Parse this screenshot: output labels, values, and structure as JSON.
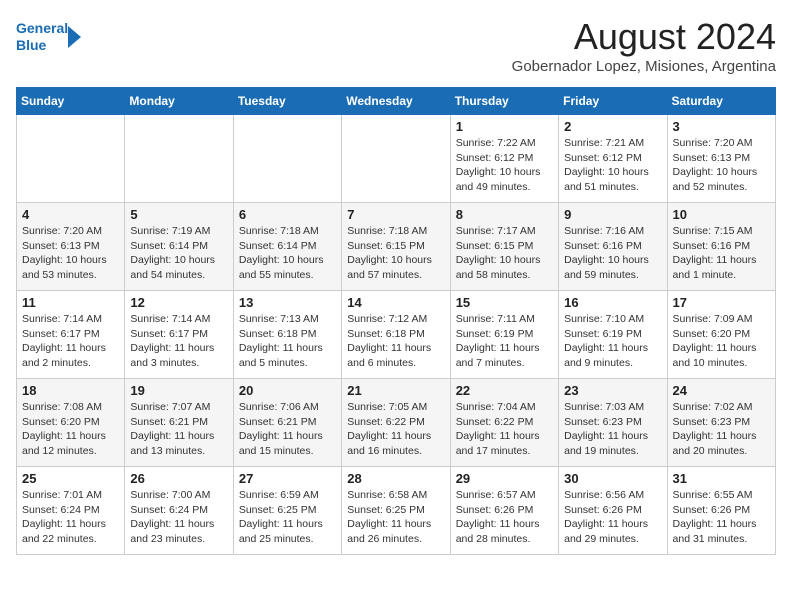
{
  "header": {
    "logo_line1": "General",
    "logo_line2": "Blue",
    "main_title": "August 2024",
    "subtitle": "Gobernador Lopez, Misiones, Argentina"
  },
  "days_of_week": [
    "Sunday",
    "Monday",
    "Tuesday",
    "Wednesday",
    "Thursday",
    "Friday",
    "Saturday"
  ],
  "weeks": [
    [
      {
        "num": "",
        "info": ""
      },
      {
        "num": "",
        "info": ""
      },
      {
        "num": "",
        "info": ""
      },
      {
        "num": "",
        "info": ""
      },
      {
        "num": "1",
        "info": "Sunrise: 7:22 AM\nSunset: 6:12 PM\nDaylight: 10 hours\nand 49 minutes."
      },
      {
        "num": "2",
        "info": "Sunrise: 7:21 AM\nSunset: 6:12 PM\nDaylight: 10 hours\nand 51 minutes."
      },
      {
        "num": "3",
        "info": "Sunrise: 7:20 AM\nSunset: 6:13 PM\nDaylight: 10 hours\nand 52 minutes."
      }
    ],
    [
      {
        "num": "4",
        "info": "Sunrise: 7:20 AM\nSunset: 6:13 PM\nDaylight: 10 hours\nand 53 minutes."
      },
      {
        "num": "5",
        "info": "Sunrise: 7:19 AM\nSunset: 6:14 PM\nDaylight: 10 hours\nand 54 minutes."
      },
      {
        "num": "6",
        "info": "Sunrise: 7:18 AM\nSunset: 6:14 PM\nDaylight: 10 hours\nand 55 minutes."
      },
      {
        "num": "7",
        "info": "Sunrise: 7:18 AM\nSunset: 6:15 PM\nDaylight: 10 hours\nand 57 minutes."
      },
      {
        "num": "8",
        "info": "Sunrise: 7:17 AM\nSunset: 6:15 PM\nDaylight: 10 hours\nand 58 minutes."
      },
      {
        "num": "9",
        "info": "Sunrise: 7:16 AM\nSunset: 6:16 PM\nDaylight: 10 hours\nand 59 minutes."
      },
      {
        "num": "10",
        "info": "Sunrise: 7:15 AM\nSunset: 6:16 PM\nDaylight: 11 hours\nand 1 minute."
      }
    ],
    [
      {
        "num": "11",
        "info": "Sunrise: 7:14 AM\nSunset: 6:17 PM\nDaylight: 11 hours\nand 2 minutes."
      },
      {
        "num": "12",
        "info": "Sunrise: 7:14 AM\nSunset: 6:17 PM\nDaylight: 11 hours\nand 3 minutes."
      },
      {
        "num": "13",
        "info": "Sunrise: 7:13 AM\nSunset: 6:18 PM\nDaylight: 11 hours\nand 5 minutes."
      },
      {
        "num": "14",
        "info": "Sunrise: 7:12 AM\nSunset: 6:18 PM\nDaylight: 11 hours\nand 6 minutes."
      },
      {
        "num": "15",
        "info": "Sunrise: 7:11 AM\nSunset: 6:19 PM\nDaylight: 11 hours\nand 7 minutes."
      },
      {
        "num": "16",
        "info": "Sunrise: 7:10 AM\nSunset: 6:19 PM\nDaylight: 11 hours\nand 9 minutes."
      },
      {
        "num": "17",
        "info": "Sunrise: 7:09 AM\nSunset: 6:20 PM\nDaylight: 11 hours\nand 10 minutes."
      }
    ],
    [
      {
        "num": "18",
        "info": "Sunrise: 7:08 AM\nSunset: 6:20 PM\nDaylight: 11 hours\nand 12 minutes."
      },
      {
        "num": "19",
        "info": "Sunrise: 7:07 AM\nSunset: 6:21 PM\nDaylight: 11 hours\nand 13 minutes."
      },
      {
        "num": "20",
        "info": "Sunrise: 7:06 AM\nSunset: 6:21 PM\nDaylight: 11 hours\nand 15 minutes."
      },
      {
        "num": "21",
        "info": "Sunrise: 7:05 AM\nSunset: 6:22 PM\nDaylight: 11 hours\nand 16 minutes."
      },
      {
        "num": "22",
        "info": "Sunrise: 7:04 AM\nSunset: 6:22 PM\nDaylight: 11 hours\nand 17 minutes."
      },
      {
        "num": "23",
        "info": "Sunrise: 7:03 AM\nSunset: 6:23 PM\nDaylight: 11 hours\nand 19 minutes."
      },
      {
        "num": "24",
        "info": "Sunrise: 7:02 AM\nSunset: 6:23 PM\nDaylight: 11 hours\nand 20 minutes."
      }
    ],
    [
      {
        "num": "25",
        "info": "Sunrise: 7:01 AM\nSunset: 6:24 PM\nDaylight: 11 hours\nand 22 minutes."
      },
      {
        "num": "26",
        "info": "Sunrise: 7:00 AM\nSunset: 6:24 PM\nDaylight: 11 hours\nand 23 minutes."
      },
      {
        "num": "27",
        "info": "Sunrise: 6:59 AM\nSunset: 6:25 PM\nDaylight: 11 hours\nand 25 minutes."
      },
      {
        "num": "28",
        "info": "Sunrise: 6:58 AM\nSunset: 6:25 PM\nDaylight: 11 hours\nand 26 minutes."
      },
      {
        "num": "29",
        "info": "Sunrise: 6:57 AM\nSunset: 6:26 PM\nDaylight: 11 hours\nand 28 minutes."
      },
      {
        "num": "30",
        "info": "Sunrise: 6:56 AM\nSunset: 6:26 PM\nDaylight: 11 hours\nand 29 minutes."
      },
      {
        "num": "31",
        "info": "Sunrise: 6:55 AM\nSunset: 6:26 PM\nDaylight: 11 hours\nand 31 minutes."
      }
    ]
  ]
}
